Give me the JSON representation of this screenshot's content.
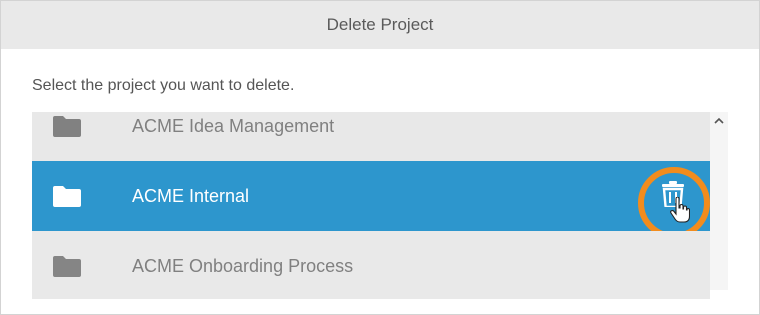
{
  "dialog": {
    "title": "Delete Project",
    "instruction": "Select the project you want to delete."
  },
  "projects": [
    {
      "label": "ACME Idea Management",
      "icon": "folder-icon",
      "selected": false
    },
    {
      "label": "ACME Internal",
      "icon": "folder-icon",
      "selected": true
    },
    {
      "label": "ACME Onboarding Process",
      "icon": "folder-icon",
      "selected": false
    }
  ],
  "colors": {
    "selected_row": "#2d96cd",
    "highlight_ring": "#f28c1d",
    "header_bg": "#e9e9e9"
  },
  "icons": {
    "delete": "trash-icon",
    "pointer": "hand-cursor-icon",
    "scroll_up": "chevron-up-icon"
  }
}
